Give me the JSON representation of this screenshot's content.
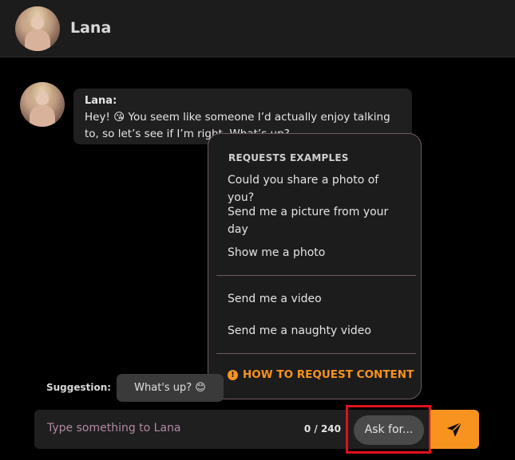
{
  "header": {
    "name": "Lana"
  },
  "message": {
    "sender": "Lana:",
    "text": "Hey! 😘 You seem like someone I’d actually enjoy talking to, so let’s see if I’m right. What’s up?"
  },
  "requests": {
    "title": "REQUESTS EXAMPLES",
    "photo_items": [
      "Could you share a photo of you?",
      "Send me a picture from your day",
      "Show me a photo"
    ],
    "video_items": [
      "Send me a video",
      "Send me a naughty video"
    ],
    "howto_label": "HOW TO REQUEST CONTENT"
  },
  "suggestion": {
    "label": "Suggestion:",
    "chip": "What's up? 😊"
  },
  "composer": {
    "placeholder": "Type something to Lana",
    "char_count": "0 / 240",
    "ask_for_label": "Ask for..."
  },
  "colors": {
    "accent": "#f7931e",
    "highlight": "#e0101c"
  },
  "icons": {
    "send": "paper-plane-icon",
    "info": "info-icon"
  }
}
